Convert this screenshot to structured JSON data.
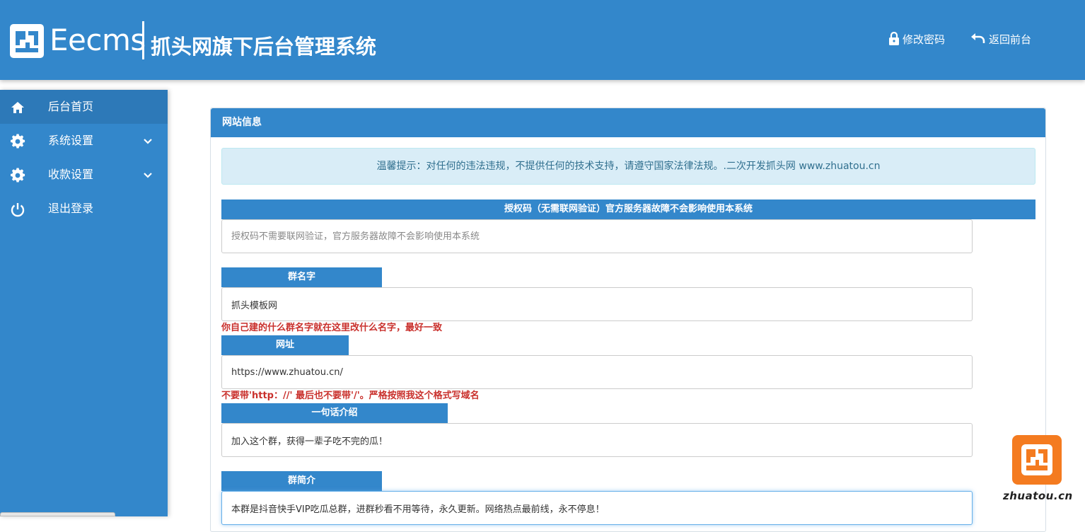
{
  "header": {
    "brand": "Eecms",
    "title": "抓头网旗下后台管理系统",
    "change_password": "修改密码",
    "back_to_front": "返回前台"
  },
  "sidebar": {
    "items": [
      {
        "label": "后台首页",
        "icon": "home-icon",
        "active": true
      },
      {
        "label": "系统设置",
        "icon": "gear-icon",
        "expandable": true
      },
      {
        "label": "收款设置",
        "icon": "gear-icon",
        "expandable": true
      },
      {
        "label": "退出登录",
        "icon": "power-icon"
      }
    ]
  },
  "panel": {
    "title": "网站信息",
    "notice": "温馨提示：对任何的违法违规，不提供任何的技术支持，请遵守国家法律法规。.二次开发抓头网 www.zhuatou.cn",
    "fields": [
      {
        "label": "授权码（无需联网验证）官方服务器故障不会影响使用本系统",
        "value": "",
        "placeholder": "授权码不需要联网验证，官方服务器故障不会影响使用本系统"
      },
      {
        "label": "群名字",
        "value": "抓头模板网",
        "hint": "你自己建的什么群名字就在这里改什么名字，最好一致"
      },
      {
        "label": "网址",
        "value": "https://www.zhuatou.cn/",
        "hint": "不要带'http：//' 最后也不要带'/'。严格按照我这个格式写域名"
      },
      {
        "label": "一句话介绍",
        "value": "加入这个群，获得一辈子吃不完的瓜！"
      },
      {
        "label": "群简介",
        "value": "本群是抖音快手VIP吃瓜总群，进群秒看不用等待，永久更新。网络热点最前线，永不停息！"
      }
    ]
  },
  "watermark": {
    "text": "zhuatou.cn"
  },
  "colors": {
    "primary": "#3387cb",
    "notice_bg": "#d9edf7",
    "notice_text": "#31708f",
    "hint": "#c9302c",
    "watermark": "#f47b20"
  }
}
